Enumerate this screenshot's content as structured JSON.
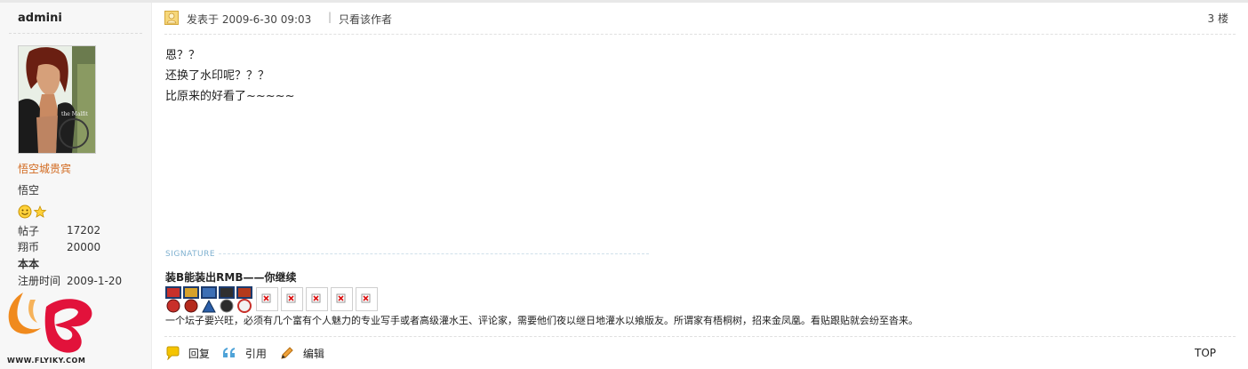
{
  "user": {
    "name": "admini",
    "group": "悟空城贵宾",
    "custom_title": "悟空",
    "stats": [
      {
        "label": "帖子",
        "value": "17202"
      },
      {
        "label": "翔币",
        "value": "20000"
      },
      {
        "label": "本本",
        "value": ""
      },
      {
        "label": "注册时间",
        "value": "2009-1-20"
      }
    ],
    "site_logo_text": "WWW.FLYIKY.COM"
  },
  "post": {
    "posted_at": "发表于  2009-6-30 09:03",
    "separator": "|",
    "author_only": "只看该作者",
    "floor": "3 楼",
    "lines": [
      "恩？？",
      "还换了水印呢？？？",
      "比原来的好看了~~~~~"
    ]
  },
  "signature": {
    "label": "SIGNATURE",
    "title": "装B能装出RMB——你继续",
    "text": "一个坛子要兴旺，必须有几个富有个人魅力的专业写手或者高级灌水王、评论家，需要他们夜以继日地灌水以飨版友。所谓家有梧桐树，招来金凤凰。看贴跟贴就会纷至沓来。"
  },
  "actions": {
    "reply": "回复",
    "quote": "引用",
    "edit": "编辑",
    "top": "TOP"
  },
  "colors": {
    "group": "#d2691e",
    "sidebar_bg": "#f7f7f7",
    "signature_label": "#7fb1d0"
  }
}
